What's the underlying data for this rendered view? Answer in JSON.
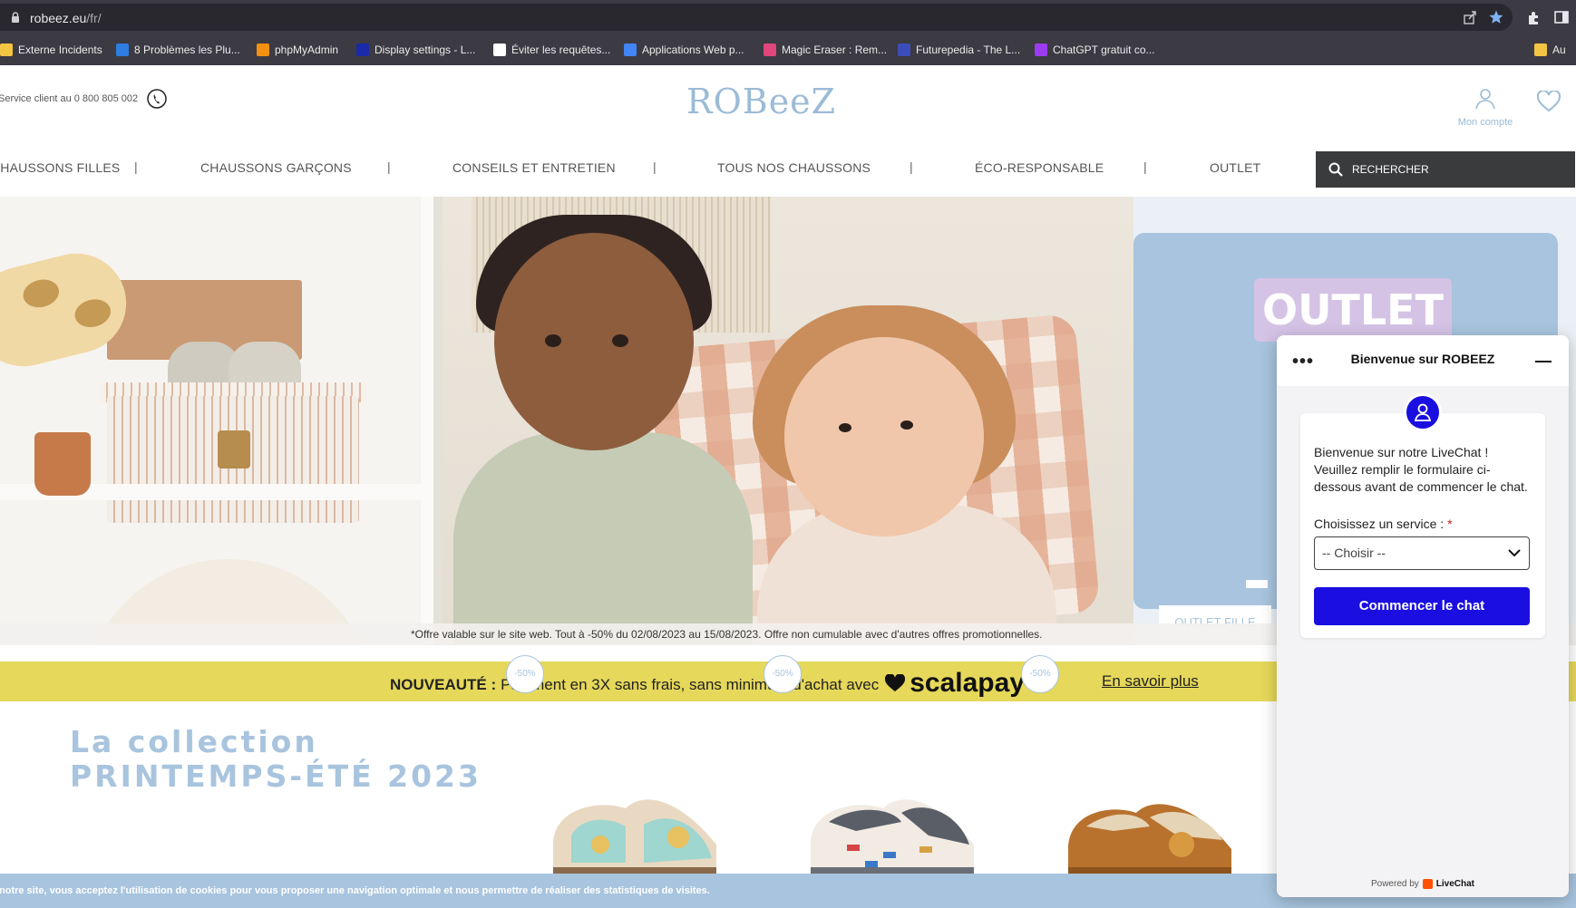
{
  "browser": {
    "url_host": "robeez.eu",
    "url_path": "/fr/",
    "icons": [
      "share-icon",
      "star-icon",
      "extensions-icon",
      "sidepanel-icon"
    ],
    "bookmarks": [
      {
        "label": "Externe Incidents",
        "icon": "folder-icon",
        "color": "#f4c542"
      },
      {
        "label": "8 Problèmes les Plu...",
        "icon": "c-icon",
        "color": "#2e7de1"
      },
      {
        "label": "phpMyAdmin",
        "icon": "sail-icon",
        "color": "#f29111"
      },
      {
        "label": "Display settings - L...",
        "icon": "l-icon",
        "color": "#1a2aa8"
      },
      {
        "label": "Éviter les requêtes...",
        "icon": "sql-icon",
        "color": "#ffffff"
      },
      {
        "label": "Applications Web p...",
        "icon": "apps-icon",
        "color": "#4285f4"
      },
      {
        "label": "Magic Eraser : Rem...",
        "icon": "eraser-icon",
        "color": "#e0457b"
      },
      {
        "label": "Futurepedia - The L...",
        "icon": "f-icon",
        "color": "#3b4db8"
      },
      {
        "label": "ChatGPT gratuit co...",
        "icon": "g-icon",
        "color": "#9b3cf0"
      },
      {
        "label": "Au",
        "icon": "folder-icon",
        "color": "#f4c542"
      }
    ]
  },
  "header": {
    "service_text": "Service client au 0 800 805 002",
    "logo": "ROBeeZ",
    "account_label": "Mon compte",
    "brand_color": "#9bbbd6"
  },
  "nav": {
    "items": [
      "CHAUSSONS FILLES",
      "CHAUSSONS GARÇONS",
      "CONSEILS ET ENTRETIEN",
      "TOUS NOS CHAUSSONS",
      "ÉCO-RESPONSABLE",
      "OUTLET"
    ],
    "separator": "|",
    "search_label": "RECHERCHER"
  },
  "hero": {
    "outlet_title": "OUTLET",
    "outlet_button": "OUTLET FILLE",
    "offer_note": "*Offre valable sur le site web. Tout à -50% du 02/08/2023 au 15/08/2023. Offre non cumulable avec d'autres offres promotionnelles."
  },
  "promo": {
    "bold": "NOUVEAUTÉ :",
    "text": "Paiement en 3X sans frais, sans minimum d'achat avec",
    "brand": "scalapay",
    "link": "En savoir plus",
    "bg_color": "#e6d85a"
  },
  "collection": {
    "line1": "La collection",
    "line2": "PRINTEMPS-ÉTÉ 2023",
    "discount_badges": [
      "-50%",
      "-50%",
      "-50%"
    ]
  },
  "cookie": {
    "text": "notre site, vous acceptez l'utilisation de cookies pour vous proposer une navigation optimale et nous permettre de réaliser des statistiques de visites."
  },
  "chat": {
    "title": "Bienvenue sur ROBEEZ",
    "message": "Bienvenue sur notre LiveChat ! Veuillez remplir le formulaire ci-dessous avant de commencer le chat.",
    "service_label": "Choisissez un service :",
    "required_mark": "*",
    "select_value": "-- Choisir --",
    "start_button": "Commencer le chat",
    "powered_by": "Powered by",
    "powered_brand": "LiveChat",
    "accent_color": "#1a0fe0"
  }
}
